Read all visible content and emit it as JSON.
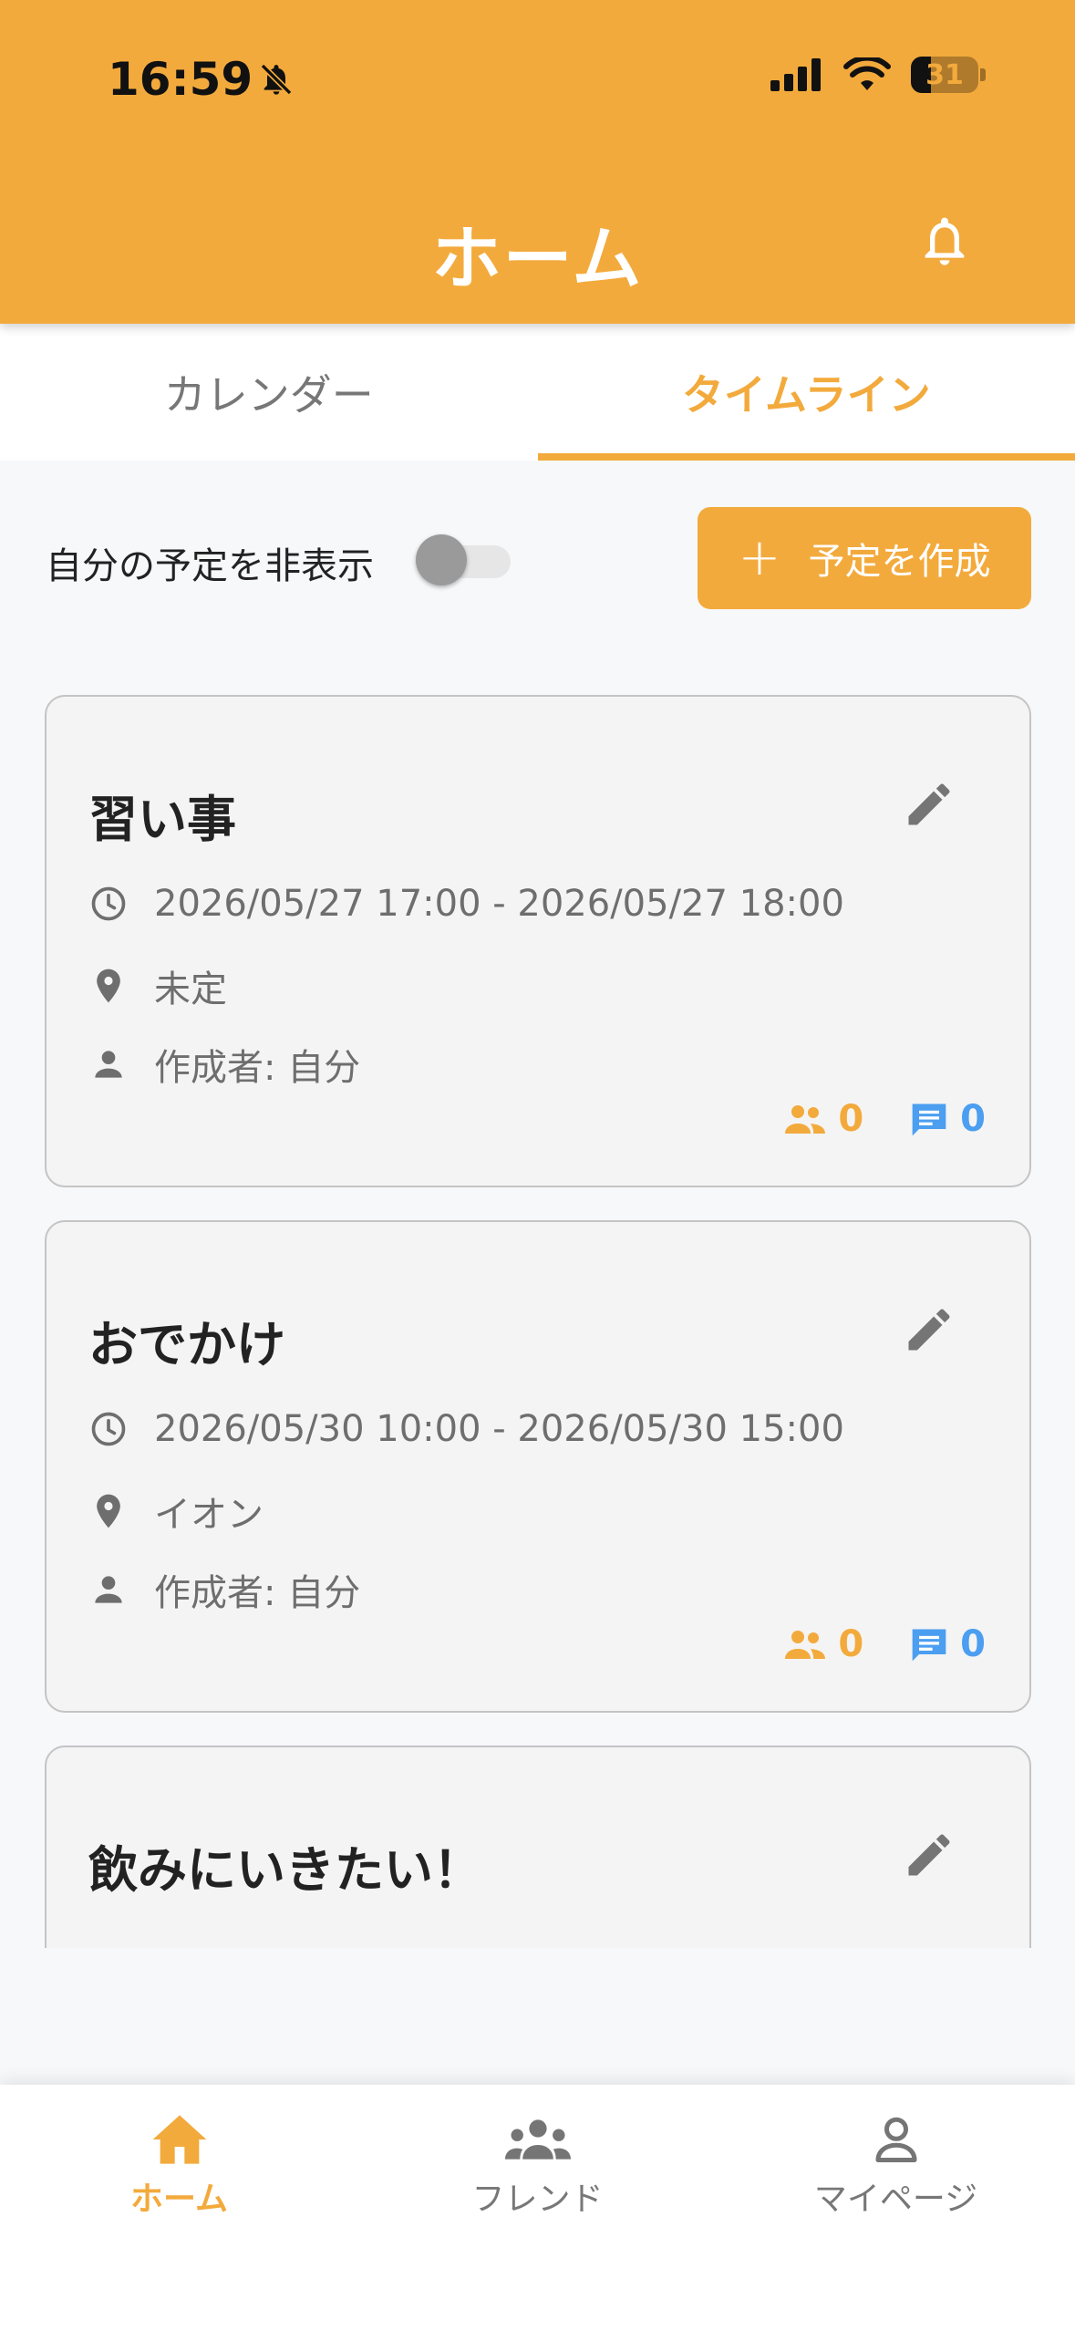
{
  "status_bar": {
    "time": "16:59",
    "battery": "31"
  },
  "header": {
    "title": "ホーム"
  },
  "tabs": [
    {
      "label": "カレンダー",
      "active": false
    },
    {
      "label": "タイムライン",
      "active": true
    }
  ],
  "toolbar": {
    "hide_own_label": "自分の予定を非表示",
    "hide_own_on": false,
    "create_label": "予定を作成"
  },
  "events": [
    {
      "title": "習い事",
      "time": "2026/05/27 17:00 - 2026/05/27 18:00",
      "location": "未定",
      "creator": "作成者: 自分",
      "participants": "0",
      "comments": "0"
    },
    {
      "title": "おでかけ",
      "time": "2026/05/30 10:00 - 2026/05/30 15:00",
      "location": "イオン",
      "creator": "作成者: 自分",
      "participants": "0",
      "comments": "0"
    },
    {
      "title": "飲みにいきたい！"
    }
  ],
  "nav": [
    {
      "label": "ホーム",
      "icon": "home-icon",
      "active": true
    },
    {
      "label": "フレンド",
      "icon": "friends-icon",
      "active": false
    },
    {
      "label": "マイページ",
      "icon": "person-icon",
      "active": false
    }
  ],
  "colors": {
    "accent": "#f3aa3c",
    "comment": "#4b9ef0",
    "muted": "#6e6e6e"
  }
}
